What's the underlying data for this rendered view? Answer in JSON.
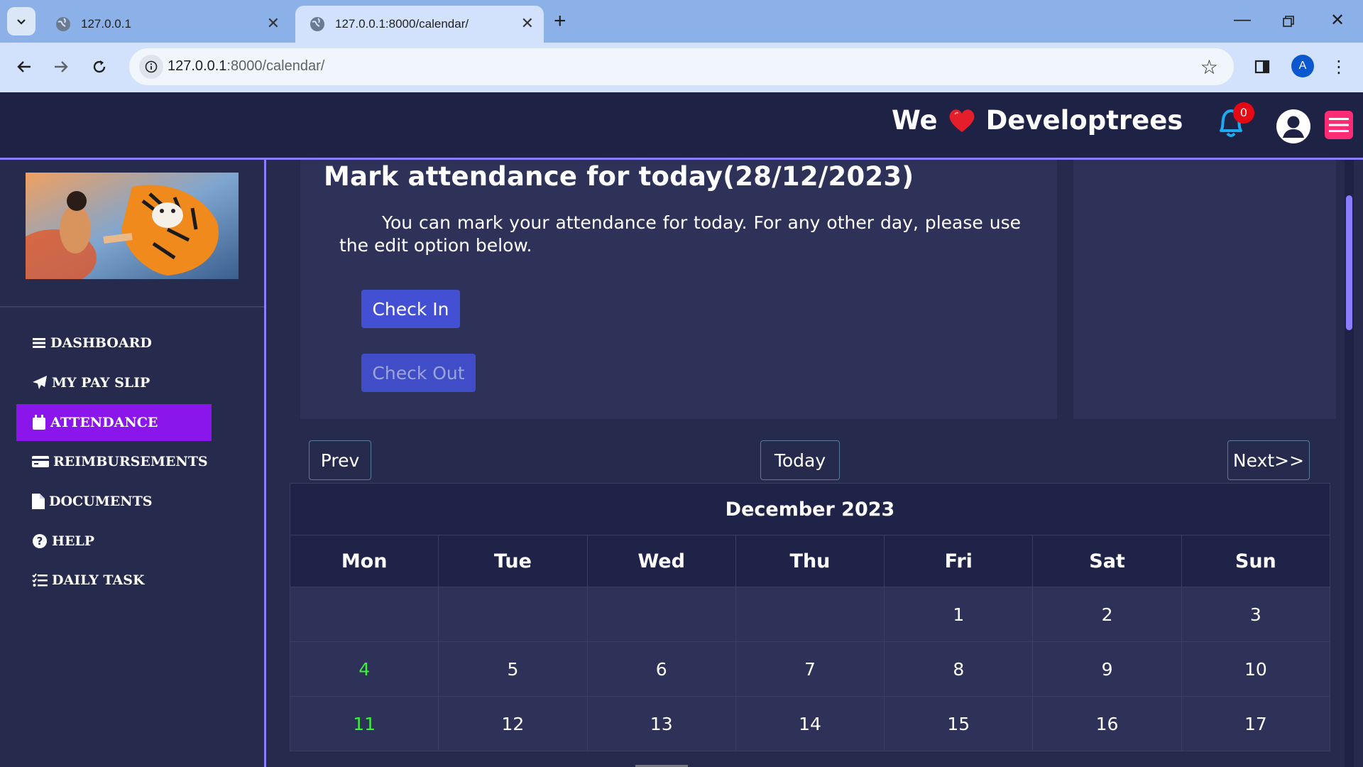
{
  "browser": {
    "tabs": [
      {
        "title": "127.0.0.1",
        "active": false
      },
      {
        "title": "127.0.0.1:8000/calendar/",
        "active": true
      }
    ],
    "url_host": "127.0.0.1",
    "url_path": ":8000/calendar/",
    "profile_initial": "A"
  },
  "header": {
    "brand_left": "We",
    "brand_right": "Developtrees",
    "notification_count": "0",
    "icons": [
      "heart-icon",
      "bell-icon",
      "user-icon",
      "hamburger-menu-icon"
    ],
    "accent_color": "#8b7dff",
    "heart_color": "#e41e2b"
  },
  "sidebar": {
    "items": [
      {
        "label": "DASHBOARD",
        "icon": "bars-icon",
        "active": false
      },
      {
        "label": "MY PAY SLIP",
        "icon": "paper-plane-icon",
        "active": false
      },
      {
        "label": "ATTENDANCE",
        "icon": "calendar-icon",
        "active": true
      },
      {
        "label": "REIMBURSEMENTS",
        "icon": "credit-card-icon",
        "active": false
      },
      {
        "label": "DOCUMENTS",
        "icon": "file-icon",
        "active": false
      },
      {
        "label": "HELP",
        "icon": "question-circle-icon",
        "active": false
      },
      {
        "label": "DAILY TASK",
        "icon": "task-list-icon",
        "active": false
      }
    ],
    "active_color": "#8a16ec"
  },
  "attendance": {
    "title": "Mark attendance for today(28/12/2023)",
    "text": "You can mark your attendance for today. For any other day, please use the edit option below.",
    "check_in_label": "Check In",
    "check_out_label": "Check Out"
  },
  "calendar": {
    "prev_label": "Prev",
    "today_label": "Today",
    "next_label": "Next>>",
    "month": "December 2023",
    "weekdays": [
      "Mon",
      "Tue",
      "Wed",
      "Thu",
      "Fri",
      "Sat",
      "Sun"
    ],
    "weeks": [
      [
        "",
        "",
        "",
        "",
        "1",
        "2",
        "3"
      ],
      [
        "4",
        "5",
        "6",
        "7",
        "8",
        "9",
        "10"
      ],
      [
        "11",
        "12",
        "13",
        "14",
        "15",
        "16",
        "17"
      ]
    ],
    "highlight_color": "#3cf03c"
  }
}
